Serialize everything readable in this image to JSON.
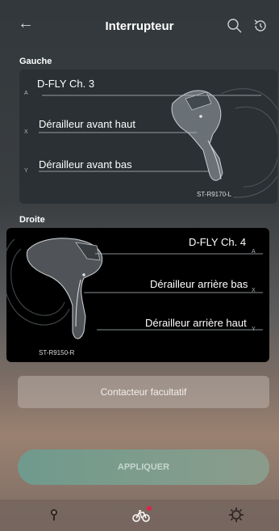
{
  "header": {
    "title": "Interrupteur",
    "back_icon": "arrow-left-icon",
    "search_icon": "search-icon",
    "refresh_icon": "refresh-icon"
  },
  "left": {
    "section_label": "Gauche",
    "top_label": "D-FLY Ch. 3",
    "mid_label": "Dérailleur avant haut",
    "bottom_label": "Dérailleur avant bas",
    "marker_a": "A",
    "marker_x": "X",
    "marker_y": "Y",
    "model": "ST-R9170-L"
  },
  "right": {
    "section_label": "Droite",
    "top_label": "D-FLY Ch. 4",
    "mid_label": "Dérailleur arrière bas",
    "bottom_label": "Dérailleur arrière haut",
    "marker_a": "A",
    "marker_x": "X",
    "marker_y": "Y",
    "model": "ST-R9150-R"
  },
  "optional_button": "Contacteur facultatif",
  "apply_button": "APPLIQUER",
  "bottom_nav": {
    "left_icon": "pin-icon",
    "center_icon": "bicycle-icon",
    "right_icon": "gear-icon",
    "notification_color": "#e0224a"
  },
  "colors": {
    "apply_bg": "#7a9a8d"
  }
}
